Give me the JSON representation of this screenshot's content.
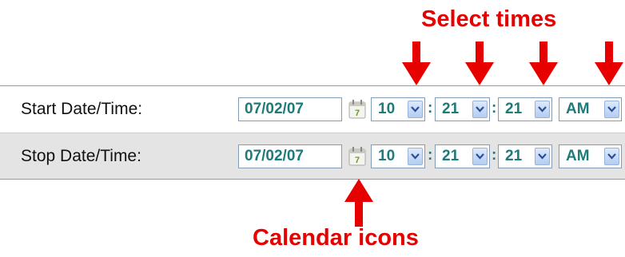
{
  "annotations": {
    "select_times": "Select times",
    "calendar_icons": "Calendar icons"
  },
  "colors": {
    "annotation": "#e60000",
    "value_text": "#1f7a7a",
    "row_alt_bg": "#e4e4e4"
  },
  "rows": [
    {
      "label": "Start Date/Time:",
      "date": "07/02/07",
      "hour": "10",
      "minute": "21",
      "second": "21",
      "ampm": "AM"
    },
    {
      "label": "Stop Date/Time:",
      "date": "07/02/07",
      "hour": "10",
      "minute": "21",
      "second": "21",
      "ampm": "AM"
    }
  ],
  "separator": ":",
  "icons": {
    "calendar": "calendar-icon",
    "dropdown": "chevron-down-icon",
    "arrow": "arrow-down-icon"
  }
}
